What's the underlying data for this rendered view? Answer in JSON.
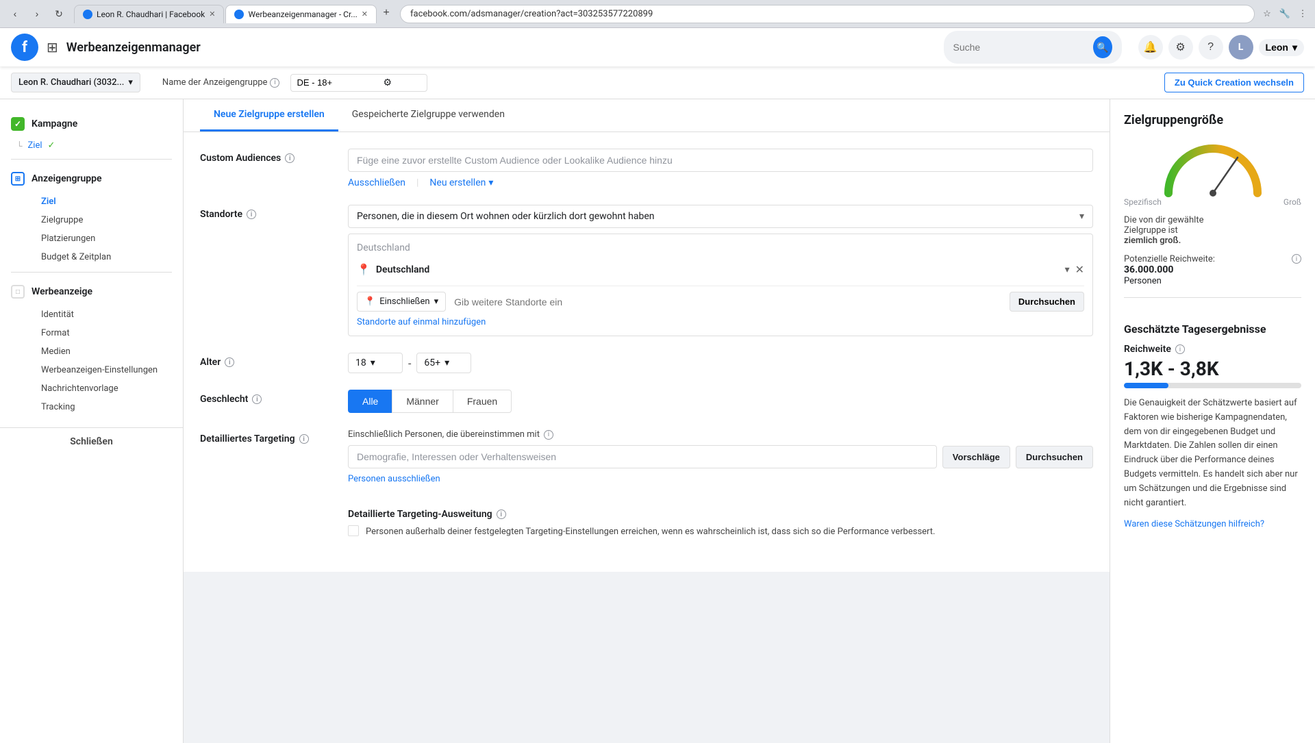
{
  "browser": {
    "tabs": [
      {
        "id": "tab1",
        "label": "Leon R. Chaudhari | Facebook",
        "favicon_type": "fb",
        "active": false
      },
      {
        "id": "tab2",
        "label": "Werbeanzeigenmanager - Cr...",
        "favicon_type": "fb",
        "active": true
      }
    ],
    "address": "facebook.com/adsmanager/creation?act=303253577220899",
    "new_tab_label": "+"
  },
  "nav": {
    "logo_letter": "f",
    "app_name": "Werbeanzeigenmanager",
    "search_placeholder": "Suche",
    "user_name": "Leon",
    "grid_icon": "⊞"
  },
  "sub_header": {
    "account": "Leon R. Chaudhari (3032...",
    "dropdown_icon": "▾",
    "field_label": "Name der Anzeigengruppe",
    "info_icon": "ℹ",
    "field_value": "DE - 18+",
    "settings_icon": "⚙",
    "quick_creation_btn": "Zu Quick Creation wechseln"
  },
  "tabs": {
    "tab1_label": "Neue Zielgruppe erstellen",
    "tab2_label": "Gespeicherte Zielgruppe verwenden"
  },
  "sidebar": {
    "kampagne_label": "Kampagne",
    "ziel_label": "Ziel",
    "anzeigengruppe_label": "Anzeigengruppe",
    "ziel2_label": "Ziel",
    "zielgruppe_label": "Zielgruppe",
    "platzierungen_label": "Platzierungen",
    "budget_label": "Budget & Zeitplan",
    "werbeanzeige_label": "Werbeanzeige",
    "identitaet_label": "Identität",
    "format_label": "Format",
    "medien_label": "Medien",
    "einstellungen_label": "Werbeanzeigen-Einstellungen",
    "nachrichtenvorlage_label": "Nachrichtenvorlage",
    "tracking_label": "Tracking",
    "close_label": "Schließen"
  },
  "form": {
    "custom_audiences_label": "Custom Audiences",
    "custom_audiences_placeholder": "Füge eine zuvor erstellte Custom Audience oder Lookalike Audience hinzu",
    "ausschliessen_label": "Ausschließen",
    "neu_erstellen_label": "Neu erstellen",
    "standorte_label": "Standorte",
    "standorte_option": "Personen, die in diesem Ort wohnen oder kürzlich dort gewohnt haben",
    "deutschland_header": "Deutschland",
    "deutschland_tag": "Deutschland",
    "einschliessen_label": "Einschließen",
    "standort_placeholder": "Gib weitere Standorte ein",
    "durchsuchen_label": "Durchsuchen",
    "standorte_hinzufuegen": "Standorte auf einmal hinzufügen",
    "alter_label": "Alter",
    "alter_min": "18",
    "alter_max": "65+",
    "geschlecht_label": "Geschlecht",
    "alle_label": "Alle",
    "maenner_label": "Männer",
    "frauen_label": "Frauen",
    "targeting_label": "Detailliertes Targeting",
    "targeting_sublabel": "Einschließlich Personen, die übereinstimmen mit",
    "targeting_placeholder": "Demografie, Interessen oder Verhaltensweisen",
    "vorschlaege_label": "Vorschläge",
    "durchsuchen2_label": "Durchsuchen",
    "personen_ausschliessen_label": "Personen ausschließen",
    "expand_label": "Detaillierte Targeting-Ausweitung",
    "expand_info_icon": "ℹ",
    "expand_text": "Personen außerhalb deiner festgelegten Targeting-Einstellungen erreichen, wenn es wahrscheinlich ist, dass sich so die Performance verbessert."
  },
  "right_panel": {
    "title": "Zielgruppengröße",
    "zielgruppe_desc1": "Die von dir",
    "zielgruppe_desc2": "gewählte",
    "zielgruppe_desc3": "Zielgruppe ist",
    "zielgruppe_desc4": "ziemlich groß.",
    "spezifisch_label": "Spezifisch",
    "gross_label": "Groß",
    "potenzielle_label": "Potenzielle Reichweite:",
    "potenzielle_value": "36.000.000",
    "personen_label": "Personen",
    "tagesergebnisse_title": "Geschätzte Tagesergebnisse",
    "reichweite_label": "Reichweite",
    "reichweite_range": "1,3K - 3,8K",
    "desc": "Die Genauigkeit der Schätzwerte basiert auf Faktoren wie bisherige Kampagnendaten, dem von dir eingegebenen Budget und Marktdaten. Die Zahlen sollen dir einen Eindruck über die Performance deines Budgets vermitteln. Es handelt sich aber nur um Schätzungen und die Ergebnisse sind nicht garantiert.",
    "link_label": "Waren diese Schätzungen hilfreich?"
  }
}
